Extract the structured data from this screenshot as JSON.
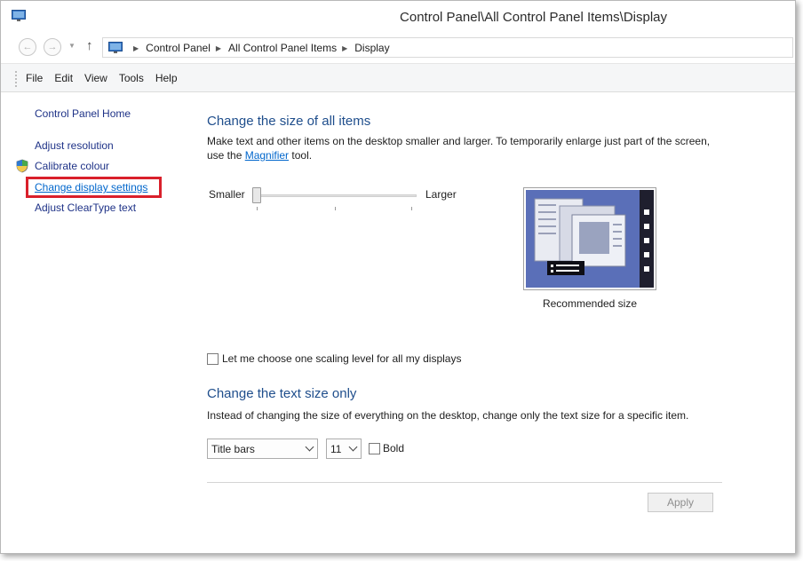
{
  "window": {
    "title": "Control Panel\\All Control Panel Items\\Display"
  },
  "address": {
    "crumbs": [
      "Control Panel",
      "All Control Panel Items",
      "Display"
    ]
  },
  "menu": [
    "File",
    "Edit",
    "View",
    "Tools",
    "Help"
  ],
  "sidebar": {
    "home": "Control Panel Home",
    "links": [
      "Adjust resolution",
      "Calibrate colour",
      "Change display settings",
      "Adjust ClearType text"
    ]
  },
  "size_section": {
    "heading": "Change the size of all items",
    "desc_before": "Make text and other items on the desktop smaller and larger. To temporarily enlarge just part of the screen, use the ",
    "magnifier_link": "Magnifier",
    "desc_after": " tool.",
    "slider": {
      "min_label": "Smaller",
      "max_label": "Larger",
      "position": 0
    },
    "preview_caption": "Recommended size"
  },
  "scaling_checkbox": {
    "label": "Let me choose one scaling level for all my displays",
    "checked": false
  },
  "text_section": {
    "heading": "Change the text size only",
    "desc": "Instead of changing the size of everything on the desktop, change only the text size for a specific item.",
    "item_select": "Title bars",
    "size_select": "11",
    "bold_label": "Bold",
    "bold_checked": false
  },
  "buttons": {
    "apply": "Apply"
  },
  "colors": {
    "heading": "#1f4e8c",
    "link": "#0066cc",
    "highlight": "#d9202b"
  }
}
